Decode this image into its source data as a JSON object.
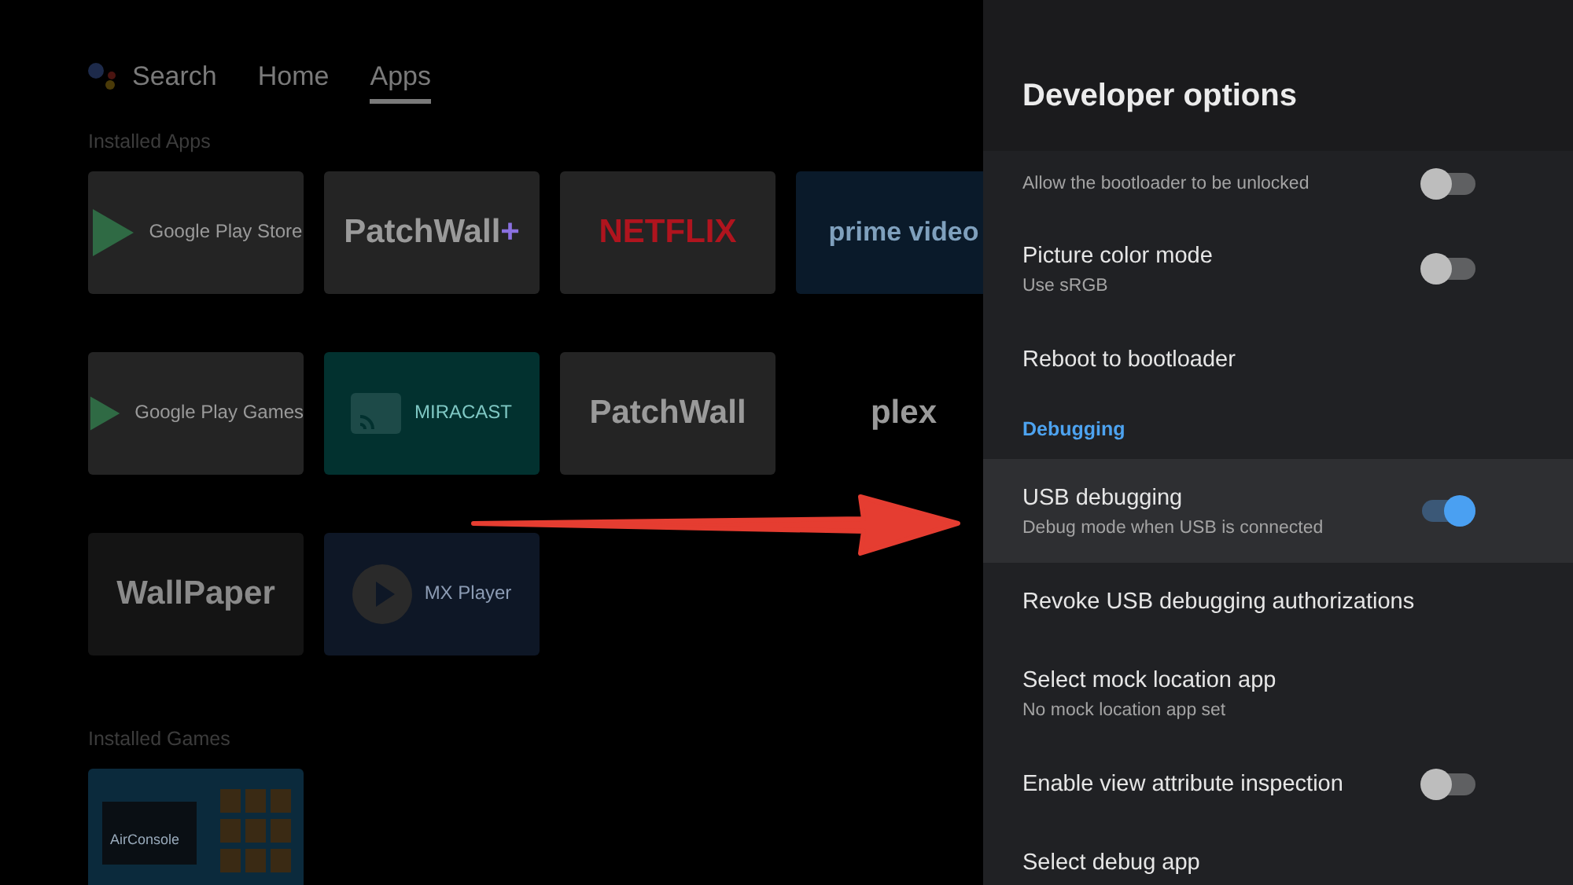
{
  "nav": {
    "items": [
      {
        "label": "Search",
        "kind": "assistant",
        "selected": false
      },
      {
        "label": "Home",
        "kind": "plain",
        "selected": false
      },
      {
        "label": "Apps",
        "kind": "plain",
        "selected": true
      }
    ]
  },
  "sections": [
    {
      "title": "Installed Apps",
      "tiles": [
        {
          "label": "Google Play Store",
          "kind": "play",
          "color": "#242424"
        },
        {
          "label": "PatchWall",
          "suffix": "+",
          "kind": "text",
          "color": "#242424"
        },
        {
          "label": "NETFLIX",
          "kind": "text",
          "color": "#242424"
        },
        {
          "label": "prime video",
          "kind": "text",
          "color": "#0a1a2a"
        },
        {
          "label": "Google Play Games",
          "kind": "play",
          "color": "#242424"
        },
        {
          "label": "MIRACAST",
          "kind": "cast",
          "color": "#02312f"
        },
        {
          "label": "PatchWall",
          "kind": "text",
          "color": "#242424"
        },
        {
          "label": "plex",
          "kind": "text",
          "color": "#000000"
        },
        {
          "label": "WallPaper",
          "kind": "text",
          "color": "#141414"
        },
        {
          "label": "MX Player",
          "kind": "circle",
          "color": "#0e1726"
        }
      ]
    },
    {
      "title": "Installed Games",
      "tiles": [
        {
          "label": "AirConsole",
          "kind": "game",
          "color": "#0b2a3c"
        }
      ]
    }
  ],
  "panel": {
    "title": "Developer options",
    "rows": [
      {
        "kind": "toggle",
        "subtitle": "Allow the bootloader to be unlocked",
        "on": false,
        "selected": false
      },
      {
        "kind": "toggle",
        "title": "Picture color mode",
        "subtitle": "Use sRGB",
        "on": false,
        "selected": false
      },
      {
        "kind": "plain",
        "title": "Reboot to bootloader",
        "selected": false
      },
      {
        "kind": "header",
        "title": "Debugging"
      },
      {
        "kind": "toggle",
        "title": "USB debugging",
        "subtitle": "Debug mode when USB is connected",
        "on": true,
        "selected": true
      },
      {
        "kind": "plain",
        "title": "Revoke USB debugging authorizations",
        "selected": false
      },
      {
        "kind": "plain",
        "title": "Select mock location app",
        "subtitle": "No mock location app set",
        "selected": false
      },
      {
        "kind": "toggle",
        "title": "Enable view attribute inspection",
        "on": false,
        "selected": false
      },
      {
        "kind": "plain",
        "title": "Select debug app",
        "selected": false
      }
    ]
  }
}
